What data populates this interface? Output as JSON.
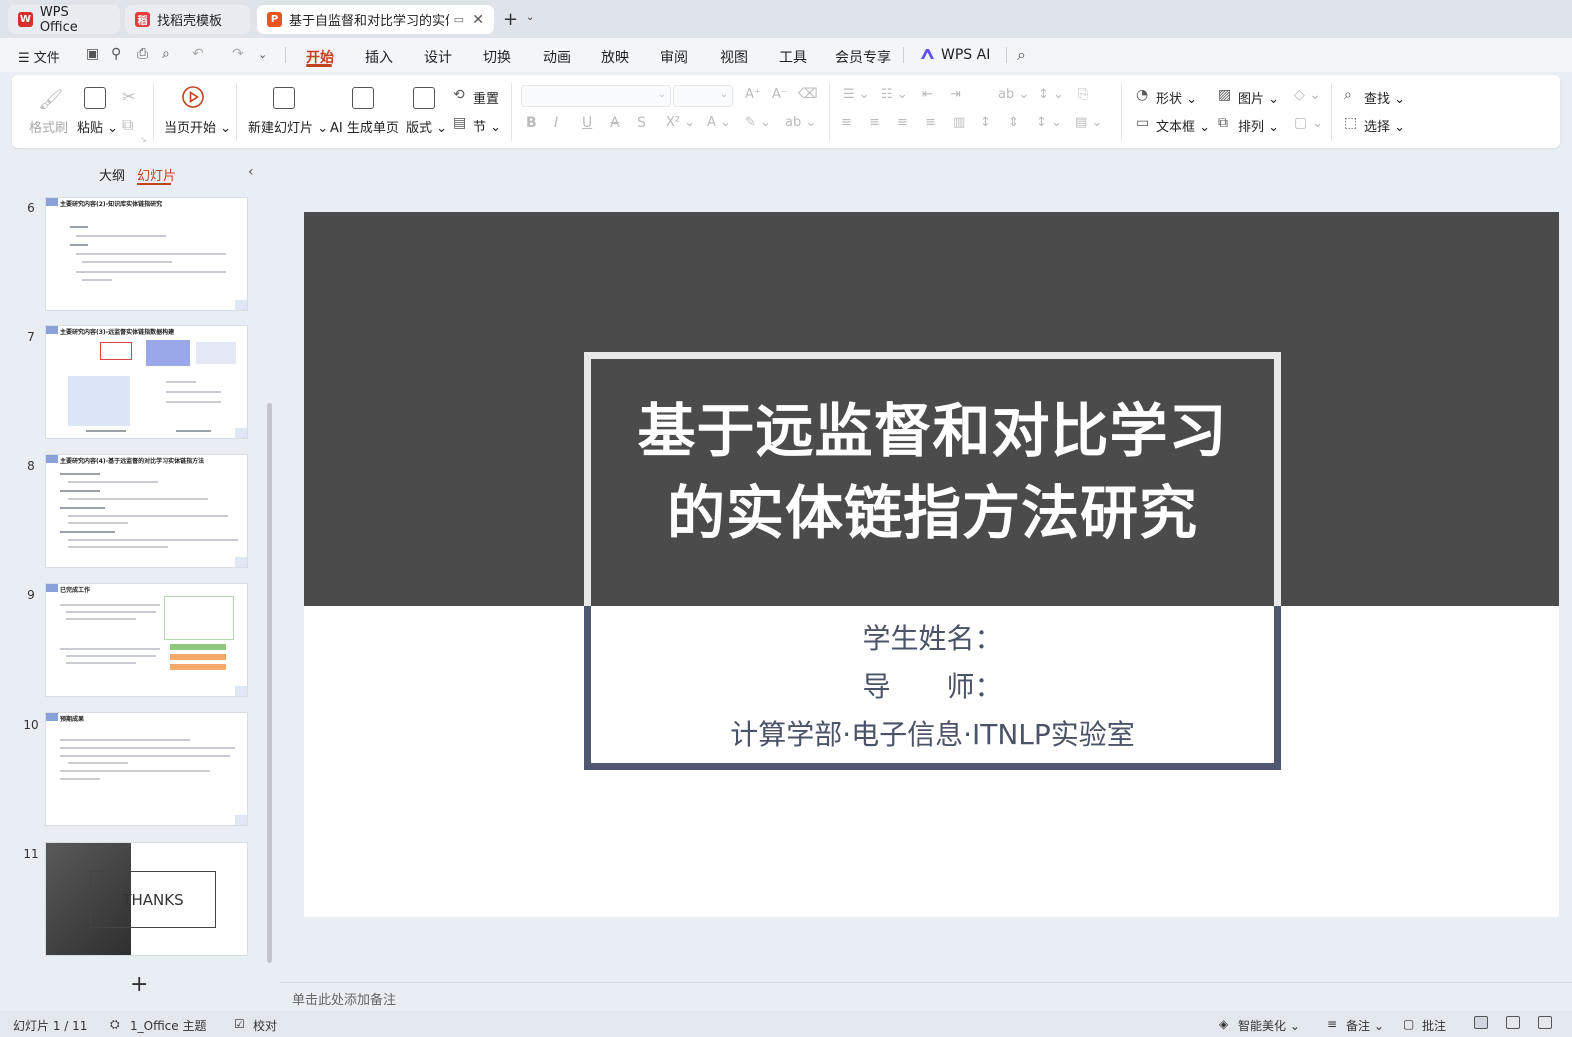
{
  "tabs": [
    {
      "label": "WPS Office",
      "logo": "W",
      "color": "#d6302c"
    },
    {
      "label": "找稻壳模板",
      "logo": "稻",
      "color": "#e53c3c"
    },
    {
      "label": "基于自监督和对比学习的实体",
      "logo": "P",
      "color": "#e8561e"
    }
  ],
  "menu": {
    "file": "文件",
    "tabs": [
      "开始",
      "插入",
      "设计",
      "切换",
      "动画",
      "放映",
      "审阅",
      "视图",
      "工具",
      "会员专享"
    ],
    "active": "开始",
    "ai": "WPS AI"
  },
  "ribbon": {
    "format_painter": "格式刷",
    "paste": "粘贴",
    "play_from_current": "当页开始",
    "new_slide": "新建幻灯片",
    "ai_generate": "AI 生成单页",
    "layout": "版式",
    "reset": "重置",
    "section": "节",
    "shapes": "形状",
    "picture": "图片",
    "textbox": "文本框",
    "arrange": "排列",
    "find": "查找",
    "select": "选择"
  },
  "left_pane": {
    "outline_tab": "大纲",
    "slides_tab": "幻灯片",
    "thumbnails": [
      {
        "num": "6",
        "title": "主要研究内容(2)-知识库实体链指研究"
      },
      {
        "num": "7",
        "title": "主要研究内容(3)-远监督实体链指数据构建"
      },
      {
        "num": "8",
        "title": "主要研究内容(4)-基于远监督的对比学习实体链指方法"
      },
      {
        "num": "9",
        "title": "已完成工作"
      },
      {
        "num": "10",
        "title": "预期成果"
      },
      {
        "num": "11",
        "title": "THANKS"
      }
    ]
  },
  "slide": {
    "title_line1": "基于远监督和对比学习",
    "title_line2": "的实体链指方法研究",
    "student": "学生姓名：",
    "advisor": "导　　师：",
    "lab": "计算学部·电子信息·ITNLP实验室"
  },
  "notes_placeholder": "单击此处添加备注",
  "status": {
    "slide_counter": "幻灯片 1 / 11",
    "theme": "1_Office 主题",
    "proof": "校对",
    "beautify": "智能美化",
    "notes": "备注",
    "comments": "批注"
  }
}
